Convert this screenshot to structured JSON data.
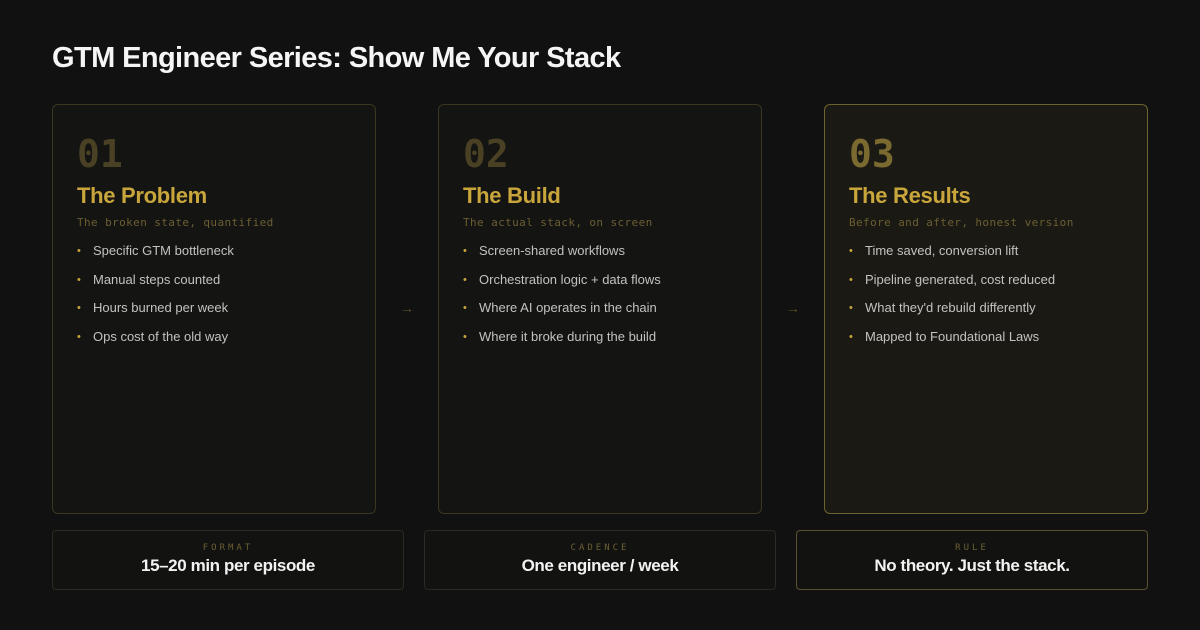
{
  "title": "GTM Engineer Series: Show Me Your Stack",
  "cards": [
    {
      "number": "01",
      "title": "The Problem",
      "subtitle": "The broken state, quantified",
      "items": [
        "Specific GTM bottleneck",
        "Manual steps counted",
        "Hours burned per week",
        "Ops cost of the old way"
      ]
    },
    {
      "number": "02",
      "title": "The Build",
      "subtitle": "The actual stack, on screen",
      "items": [
        "Screen-shared workflows",
        "Orchestration logic + data flows",
        "Where AI operates in the chain",
        "Where it broke during the build"
      ]
    },
    {
      "number": "03",
      "title": "The Results",
      "subtitle": "Before and after, honest version",
      "items": [
        "Time saved, conversion lift",
        "Pipeline generated, cost reduced",
        "What they'd rebuild differently",
        "Mapped to Foundational Laws"
      ]
    }
  ],
  "arrow_glyph": "→",
  "bullet_glyph": "•",
  "stats": [
    {
      "label": "FORMAT",
      "value": "15–20 min per episode"
    },
    {
      "label": "CADENCE",
      "value": "One engineer / week"
    },
    {
      "label": "RULE",
      "value": "No theory. Just the stack."
    }
  ],
  "colors": {
    "background": "#111111",
    "accent": "#c9a63c",
    "muted_accent": "#6b5f33"
  },
  "icons": {
    "arrow": "arrow-right-icon",
    "bullet": "bullet-icon"
  }
}
